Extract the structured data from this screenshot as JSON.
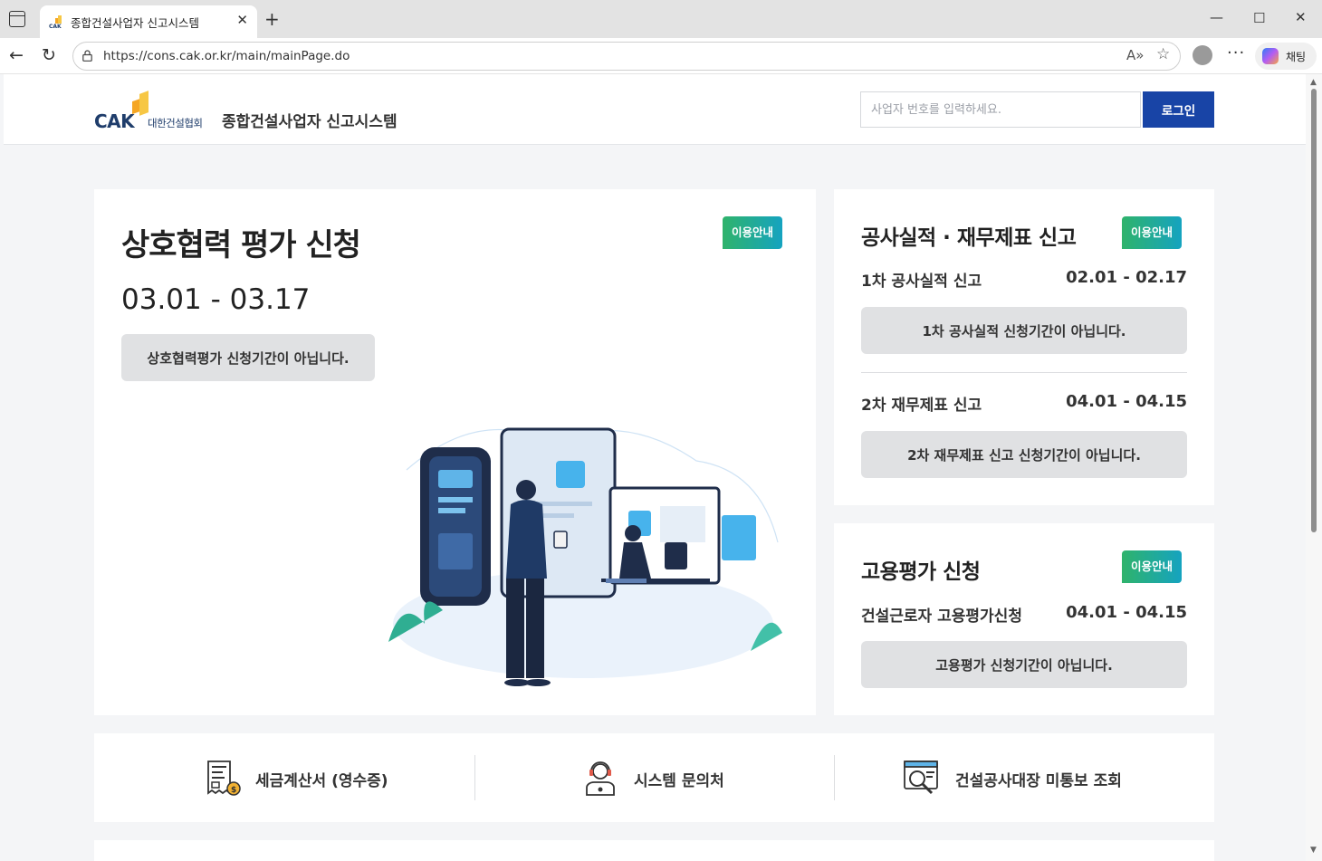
{
  "browser": {
    "tab_title": "종합건설사업자 신고시스템",
    "url": "https://cons.cak.or.kr/main/mainPage.do",
    "copilot_label": "채팅"
  },
  "header": {
    "logo_text": "CAK",
    "logo_org": "대한건설협회",
    "site_title": "종합건설사업자 신고시스템",
    "biz_input_placeholder": "사업자 번호를 입력하세요.",
    "login_label": "로그인"
  },
  "mutual": {
    "title": "상호협력 평가 신청",
    "badge": "이용안내",
    "date": "03.01 - 03.17",
    "button": "상호협력평가 신청기간이 아닙니다."
  },
  "report": {
    "title": "공사실적 · 재무제표 신고",
    "badge": "이용안내",
    "rows": [
      {
        "label": "1차 공사실적 신고",
        "date": "02.01 - 02.17",
        "button": "1차 공사실적 신청기간이 아닙니다."
      },
      {
        "label": "2차 재무제표 신고",
        "date": "04.01 - 04.15",
        "button": "2차 재무제표 신고 신청기간이 아닙니다."
      }
    ]
  },
  "employment": {
    "title": "고용평가 신청",
    "badge": "이용안내",
    "label": "건설근로자 고용평가신청",
    "date": "04.01 - 04.15",
    "button": "고용평가 신청기간이 아닙니다."
  },
  "quick_links": [
    {
      "label": "세금계산서 (영수증)",
      "icon": "receipt-icon"
    },
    {
      "label": "시스템 문의처",
      "icon": "support-agent-icon"
    },
    {
      "label": "건설공사대장 미통보 조회",
      "icon": "document-search-icon"
    }
  ],
  "colors": {
    "primary": "#1844a6",
    "badge_start": "#2fb36b",
    "badge_end": "#15a3c0",
    "button_gray": "#e0e1e3"
  }
}
